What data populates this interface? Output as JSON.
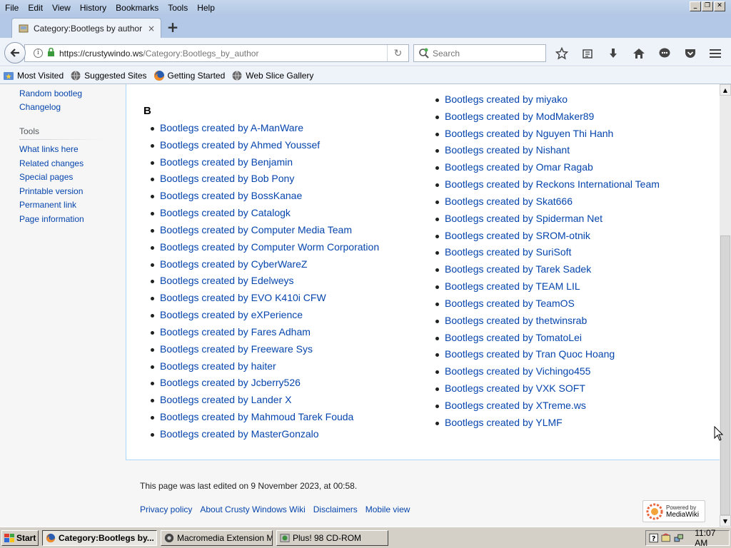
{
  "menubar": {
    "items": [
      "File",
      "Edit",
      "View",
      "History",
      "Bookmarks",
      "Tools",
      "Help"
    ]
  },
  "tab": {
    "title": "Category:Bootlegs by author ...",
    "close_label": "×",
    "new_tab_label": "+"
  },
  "navbar": {
    "url_host": "https://crustywindo.ws",
    "url_path": "/Category:Bootlegs_by_author",
    "search_placeholder": "Search"
  },
  "bookmarks": [
    {
      "label": "Most Visited",
      "icon": "star-folder-icon"
    },
    {
      "label": "Suggested Sites",
      "icon": "globe-icon"
    },
    {
      "label": "Getting Started",
      "icon": "firefox-icon"
    },
    {
      "label": "Web Slice Gallery",
      "icon": "globe-icon"
    }
  ],
  "sidebar": {
    "links_top": [
      "Random bootleg",
      "Changelog"
    ],
    "tools_heading": "Tools",
    "tools": [
      "What links here",
      "Related changes",
      "Special pages",
      "Printable version",
      "Permanent link",
      "Page information"
    ]
  },
  "main": {
    "letter": "B",
    "left_column": [
      "Bootlegs created by A-ManWare",
      "Bootlegs created by Ahmed Youssef",
      "Bootlegs created by Benjamin",
      "Bootlegs created by Bob Pony",
      "Bootlegs created by BossKanae",
      "Bootlegs created by Catalogk",
      "Bootlegs created by Computer Media Team",
      "Bootlegs created by Computer Worm Corporation",
      "Bootlegs created by CyberWareZ",
      "Bootlegs created by Edelweys",
      "Bootlegs created by EVO K410i CFW",
      "Bootlegs created by eXPerience",
      "Bootlegs created by Fares Adham",
      "Bootlegs created by Freeware Sys",
      "Bootlegs created by haiter",
      "Bootlegs created by Jcberry526",
      "Bootlegs created by Lander X",
      "Bootlegs created by Mahmoud Tarek Fouda",
      "Bootlegs created by MasterGonzalo"
    ],
    "right_column": [
      "Bootlegs created by miyako",
      "Bootlegs created by ModMaker89",
      "Bootlegs created by Nguyen Thi Hanh",
      "Bootlegs created by Nishant",
      "Bootlegs created by Omar Ragab",
      "Bootlegs created by Reckons International Team",
      "Bootlegs created by Skat666",
      "Bootlegs created by Spiderman Net",
      "Bootlegs created by SROM-otnik",
      "Bootlegs created by SuriSoft",
      "Bootlegs created by Tarek Sadek",
      "Bootlegs created by TEAM LIL",
      "Bootlegs created by TeamOS",
      "Bootlegs created by thetwinsrab",
      "Bootlegs created by TomatoLei",
      "Bootlegs created by Tran Quoc Hoang",
      "Bootlegs created by Vichingo455",
      "Bootlegs created by VXK SOFT",
      "Bootlegs created by XTreme.ws",
      "Bootlegs created by YLMF"
    ]
  },
  "footer": {
    "last_edited": "This page was last edited on 9 November 2023, at 00:58.",
    "links": [
      "Privacy policy",
      "About Crusty Windows Wiki",
      "Disclaimers",
      "Mobile view"
    ],
    "badge_small": "Powered by",
    "badge_big": "MediaWiki"
  },
  "taskbar": {
    "start_label": "Start",
    "tasks": [
      {
        "label": "Category:Bootlegs by...",
        "active": true
      },
      {
        "label": "Macromedia Extension M...",
        "active": false
      },
      {
        "label": "Plus! 98 CD-ROM",
        "active": false
      }
    ],
    "clock": "11:07 AM"
  },
  "colors": {
    "link": "#0645ad",
    "browser_chrome": "#b3c8e6",
    "taskbar": "#d4d0c8"
  }
}
